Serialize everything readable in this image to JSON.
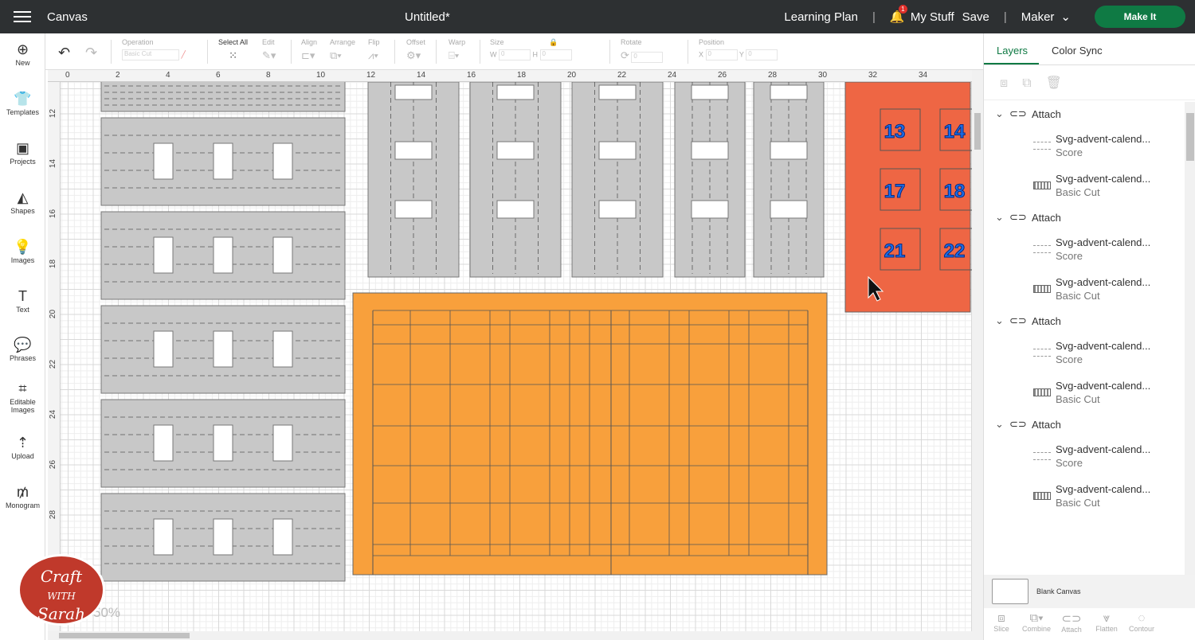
{
  "topbar": {
    "app": "Canvas",
    "doc_title": "Untitled*",
    "learning": "Learning Plan",
    "notif_count": "1",
    "mystuff": "My Stuff",
    "save": "Save",
    "machine": "Maker",
    "makeit": "Make It"
  },
  "nav": [
    {
      "label": "New",
      "icon": "plus-circle-icon"
    },
    {
      "label": "Templates",
      "icon": "shirt-icon"
    },
    {
      "label": "Projects",
      "icon": "projects-icon"
    },
    {
      "label": "Shapes",
      "icon": "shapes-icon"
    },
    {
      "label": "Images",
      "icon": "lightbulb-icon"
    },
    {
      "label": "Text",
      "icon": "text-icon"
    },
    {
      "label": "Phrases",
      "icon": "speech-bubble-icon"
    },
    {
      "label": "Editable Images",
      "icon": "editable-image-icon"
    },
    {
      "label": "Upload",
      "icon": "upload-icon"
    },
    {
      "label": "Monogram",
      "icon": "monogram-icon"
    }
  ],
  "toolbar": {
    "operation": "Operation",
    "operation_value": "Basic Cut",
    "select_all": "Select All",
    "edit": "Edit",
    "align": "Align",
    "arrange": "Arrange",
    "flip": "Flip",
    "offset": "Offset",
    "warp": "Warp",
    "size": "Size",
    "w": "W",
    "h": "H",
    "w_value": "0",
    "h_value": "0",
    "rotate": "Rotate",
    "rotate_value": "0",
    "position": "Position",
    "x": "X",
    "y": "Y",
    "x_value": "0",
    "y_value": "0"
  },
  "ruler": {
    "top": [
      "0",
      "2",
      "4",
      "6",
      "8",
      "10",
      "12",
      "14",
      "16",
      "18",
      "20",
      "22",
      "24",
      "26",
      "28",
      "30",
      "32",
      "34"
    ],
    "left": [
      "12",
      "14",
      "16",
      "18",
      "20",
      "22",
      "24",
      "26",
      "28"
    ]
  },
  "canvas": {
    "calendar_numbers": [
      "13",
      "14",
      "17",
      "18",
      "21",
      "22"
    ],
    "colors": {
      "grey": "#c8c8c8",
      "orange": "#f8a03c",
      "red": "#ee6644",
      "number_blue": "#1a6ee8"
    },
    "zoom": "50%"
  },
  "panel": {
    "tabs": [
      "Layers",
      "Color Sync"
    ],
    "groups": [
      {
        "label": "Attach",
        "items": [
          {
            "name": "Svg-advent-calend...",
            "op": "Score"
          },
          {
            "name": "Svg-advent-calend...",
            "op": "Basic Cut"
          }
        ]
      },
      {
        "label": "Attach",
        "items": [
          {
            "name": "Svg-advent-calend...",
            "op": "Score"
          },
          {
            "name": "Svg-advent-calend...",
            "op": "Basic Cut"
          }
        ]
      },
      {
        "label": "Attach",
        "items": [
          {
            "name": "Svg-advent-calend...",
            "op": "Score"
          },
          {
            "name": "Svg-advent-calend...",
            "op": "Basic Cut"
          }
        ]
      },
      {
        "label": "Attach",
        "items": [
          {
            "name": "Svg-advent-calend...",
            "op": "Score"
          },
          {
            "name": "Svg-advent-calend...",
            "op": "Basic Cut"
          }
        ]
      }
    ],
    "blank_canvas": "Blank Canvas",
    "bottom_tools": [
      "Slice",
      "Combine",
      "Attach",
      "Flatten",
      "Contour"
    ]
  },
  "watermark": "Craft with Sarah"
}
